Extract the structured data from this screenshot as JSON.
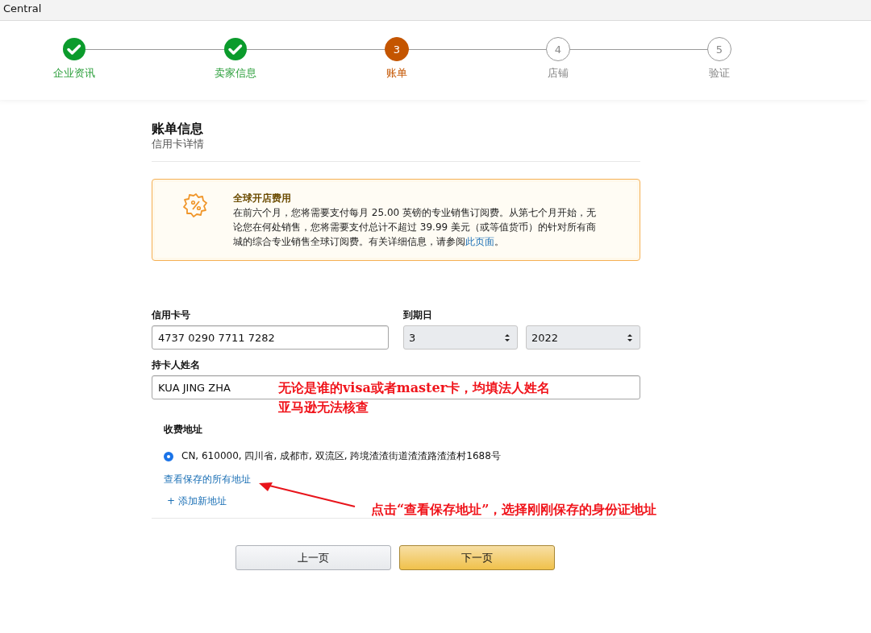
{
  "header": {
    "title": "Central"
  },
  "steps": [
    {
      "label": "企业资讯",
      "completed": true,
      "selected": false
    },
    {
      "label": "卖家信息",
      "completed": true,
      "selected": false
    },
    {
      "number": "3",
      "label": "账单",
      "completed": false,
      "selected": true
    },
    {
      "number": "4",
      "label": "店铺",
      "completed": false,
      "selected": false
    },
    {
      "number": "5",
      "label": "验证",
      "completed": false,
      "selected": false
    }
  ],
  "section": {
    "title": "账单信息",
    "subtitle": "信用卡详情"
  },
  "notice": {
    "title": "全球开店费用",
    "text": "在前六个月，您将需要支付每月 25.00 英镑的专业销售订阅费。从第七个月开始，无论您在何处销售，您将需要支付总计不超过 39.99 美元（或等值货币）的针对所有商城的综合专业销售全球订阅费。有关详细信息，请参阅",
    "link": "此页面",
    "end": "。"
  },
  "card_number": {
    "label": "信用卡号",
    "value": "4737 0290 7711 7282"
  },
  "expiry": {
    "label": "到期日",
    "month": "3",
    "year": "2022"
  },
  "cardholder": {
    "label": "持卡人姓名",
    "value": "KUA JING ZHA"
  },
  "billing_address": {
    "label": "收费地址",
    "options": [
      {
        "text": "CN, 610000, 四川省, 成都市, 双流区, 跨境渣渣街道渣渣路渣渣村1688号",
        "selected": true
      }
    ],
    "view_all_link": "查看保存的所有地址",
    "add_link": "+ 添加新地址"
  },
  "buttons": {
    "previous": "上一页",
    "next": "下一页"
  },
  "annotations": [
    {
      "kind": "note",
      "lines": [
        "无论是谁的visa或者master卡，均填法人姓名",
        "亚马逊无法核查"
      ]
    },
    {
      "kind": "arrow_note",
      "lines": [
        "点击“查看保存地址”，选择刚刚保存的身份证地址"
      ]
    }
  ]
}
